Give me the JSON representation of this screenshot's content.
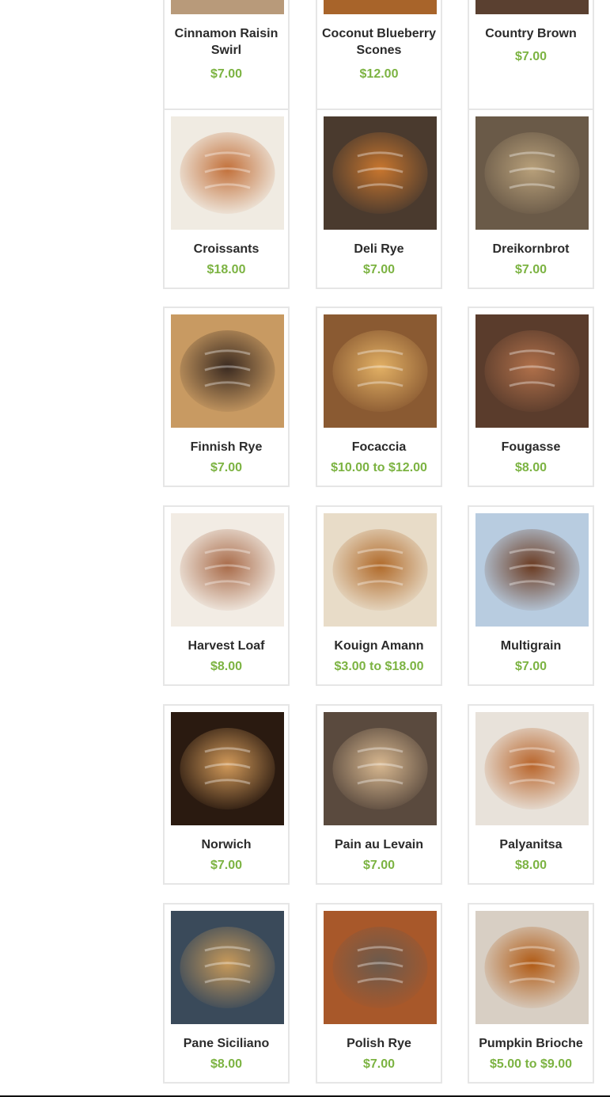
{
  "products": [
    {
      "name": "Cinnamon Raisin Swirl",
      "price": "$7.00",
      "image": "cinnamon-swirl-photo",
      "colors": [
        "#b89a7a",
        "#8a5a3a"
      ]
    },
    {
      "name": "Coconut Blueberry Scones",
      "price": "$12.00",
      "image": "scones-photo",
      "colors": [
        "#a8642a",
        "#3a2a4a"
      ]
    },
    {
      "name": "Country Brown",
      "price": "$7.00",
      "image": "country-brown-photo",
      "colors": [
        "#5a4030",
        "#2a2020"
      ]
    },
    {
      "name": "Croissants",
      "price": "$18.00",
      "image": "croissants-photo",
      "colors": [
        "#f0ebe2",
        "#c2703a"
      ]
    },
    {
      "name": "Deli Rye",
      "price": "$7.00",
      "image": "deli-rye-photo",
      "colors": [
        "#4a3a2e",
        "#c8762e"
      ]
    },
    {
      "name": "Dreikornbrot",
      "price": "$7.00",
      "image": "dreikornbrot-photo",
      "colors": [
        "#6a5a48",
        "#b8a07a"
      ]
    },
    {
      "name": "Finnish Rye",
      "price": "$7.00",
      "image": "finnish-rye-photo",
      "colors": [
        "#c89a62",
        "#3a2a20"
      ]
    },
    {
      "name": "Focaccia",
      "price": "$10.00 to $12.00",
      "image": "focaccia-photo",
      "colors": [
        "#8a5a32",
        "#e2b064"
      ]
    },
    {
      "name": "Fougasse",
      "price": "$8.00",
      "image": "fougasse-photo",
      "colors": [
        "#5a3c2c",
        "#b0704a"
      ]
    },
    {
      "name": "Harvest Loaf",
      "price": "$8.00",
      "image": "harvest-loaf-photo",
      "colors": [
        "#f2ece4",
        "#a86a48"
      ]
    },
    {
      "name": "Kouign Amann",
      "price": "$3.00 to $18.00",
      "image": "kouign-amann-photo",
      "colors": [
        "#e8dcc8",
        "#b06a2a"
      ]
    },
    {
      "name": "Multigrain",
      "price": "$7.00",
      "image": "multigrain-photo",
      "colors": [
        "#b8cce0",
        "#6a3a20"
      ]
    },
    {
      "name": "Norwich",
      "price": "$7.00",
      "image": "norwich-photo",
      "colors": [
        "#2a1a10",
        "#d29a5a"
      ]
    },
    {
      "name": "Pain au Levain",
      "price": "$7.00",
      "image": "pain-au-levain-photo",
      "colors": [
        "#5a4a3e",
        "#d8b890"
      ]
    },
    {
      "name": "Palyanitsa",
      "price": "$8.00",
      "image": "palyanitsa-photo",
      "colors": [
        "#e8e2da",
        "#b8642a"
      ]
    },
    {
      "name": "Pane Siciliano",
      "price": "$8.00",
      "image": "pane-siciliano-photo",
      "colors": [
        "#3a4a5a",
        "#c89a5a"
      ]
    },
    {
      "name": "Polish Rye",
      "price": "$7.00",
      "image": "polish-rye-photo",
      "colors": [
        "#a8582a",
        "#6a5a4e"
      ]
    },
    {
      "name": "Pumpkin Brioche",
      "price": "$5.00 to $9.00",
      "image": "pumpkin-brioche-photo",
      "colors": [
        "#d8cfc4",
        "#b05a14"
      ]
    }
  ],
  "theme": {
    "price_color": "#7cb342",
    "card_border": "#e6e6e6"
  }
}
